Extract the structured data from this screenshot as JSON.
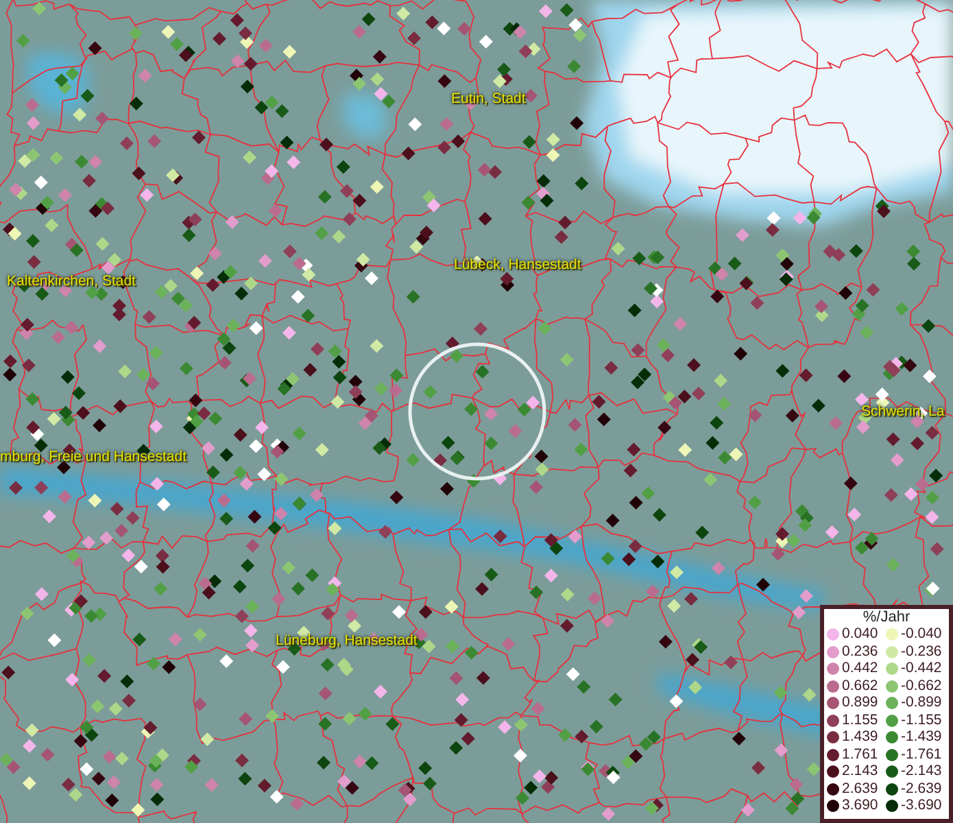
{
  "map": {
    "place_labels": [
      {
        "text": "Eutin, Stadt"
      },
      {
        "text": "Kaltenkirchen, Stadt"
      },
      {
        "text": "Lübeck, Hansestadt"
      },
      {
        "text": "Schwerin, La"
      },
      {
        "text": "mburg, Freie und Hansestadt"
      },
      {
        "text": "Lüneburg, Hansestadt"
      }
    ]
  },
  "legend": {
    "title": "%/Jahr",
    "positive": [
      {
        "label": "0.040",
        "color": "#f4b6ea"
      },
      {
        "label": "0.236",
        "color": "#e39dcd"
      },
      {
        "label": "0.442",
        "color": "#cf84ab"
      },
      {
        "label": "0.662",
        "color": "#ba6c8e"
      },
      {
        "label": "0.899",
        "color": "#a55573"
      },
      {
        "label": "1.155",
        "color": "#903f58"
      },
      {
        "label": "1.439",
        "color": "#7a2c41"
      },
      {
        "label": "1.761",
        "color": "#641b2d"
      },
      {
        "label": "2.143",
        "color": "#4c0f1c"
      },
      {
        "label": "2.639",
        "color": "#360711"
      },
      {
        "label": "3.690",
        "color": "#200207"
      }
    ],
    "negative": [
      {
        "label": "-0.040",
        "color": "#eef6b6"
      },
      {
        "label": "-0.236",
        "color": "#d0e9a4"
      },
      {
        "label": "-0.442",
        "color": "#aed889"
      },
      {
        "label": "-0.662",
        "color": "#8dc672"
      },
      {
        "label": "-0.899",
        "color": "#6cb25b"
      },
      {
        "label": "-1.155",
        "color": "#52a045"
      },
      {
        "label": "-1.439",
        "color": "#3b8a33"
      },
      {
        "label": "-1.761",
        "color": "#287225"
      },
      {
        "label": "-2.143",
        "color": "#185b18"
      },
      {
        "label": "-2.639",
        "color": "#0d450e"
      },
      {
        "label": "-3.690",
        "color": "#062d07"
      }
    ]
  }
}
